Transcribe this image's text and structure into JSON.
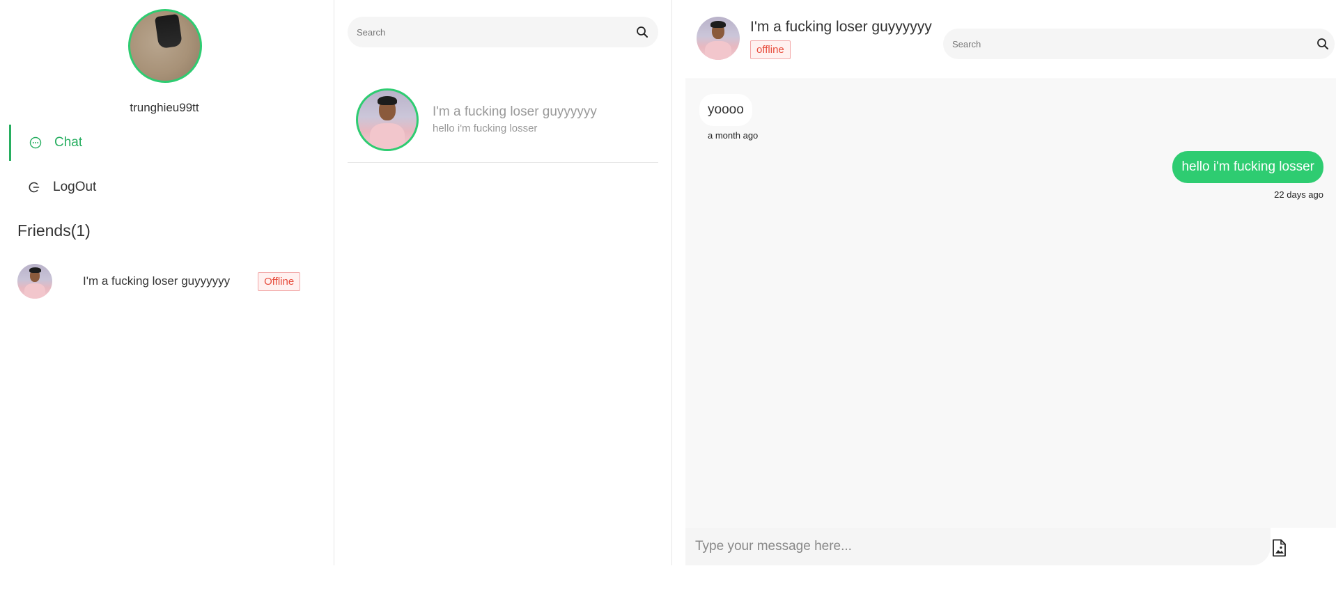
{
  "sidebar": {
    "username": "trunghieu99tt",
    "nav": {
      "chat_label": "Chat",
      "logout_label": "LogOut"
    },
    "friends_title": "Friends(1)",
    "friends": [
      {
        "name": "I'm a fucking loser guyyyyyy",
        "status": "Offline"
      }
    ]
  },
  "conversation_list": {
    "search_placeholder": "Search",
    "items": [
      {
        "name": "I'm a fucking loser guyyyyyy",
        "preview": "hello i'm fucking losser"
      }
    ]
  },
  "chat": {
    "header": {
      "name": "I'm a fucking loser guyyyyyy",
      "status": "offline"
    },
    "search_placeholder": "Search",
    "messages": [
      {
        "direction": "incoming",
        "text": "yoooo",
        "time": "a month ago"
      },
      {
        "direction": "outgoing",
        "text": "hello i'm fucking losser",
        "time": "22 days ago"
      }
    ],
    "composer_placeholder": "Type your message here..."
  },
  "colors": {
    "accent": "#2ecc71",
    "offline": "#e74c3c"
  },
  "icons": [
    "chat-icon",
    "logout-icon",
    "search-icon",
    "attach-image-icon"
  ]
}
